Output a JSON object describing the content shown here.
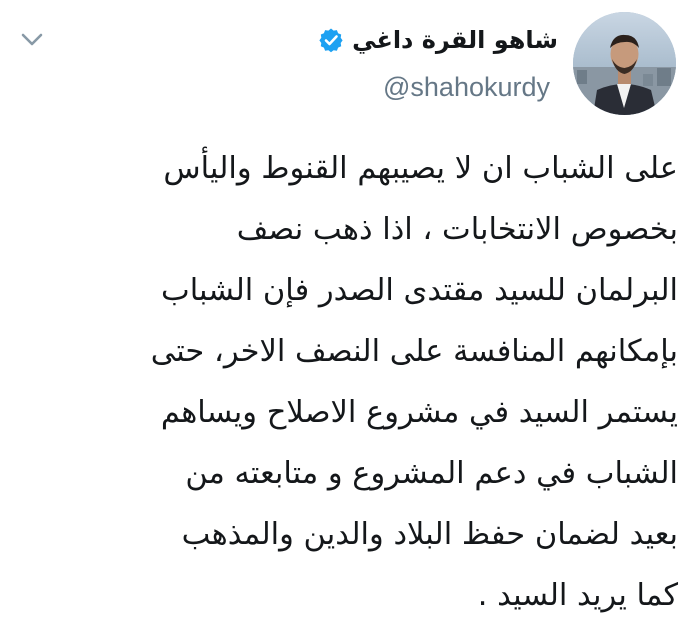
{
  "tweet": {
    "author": {
      "display_name": "شاهو القرة داغي",
      "handle": "@shahokurdy",
      "verified": true
    },
    "text_lines": [
      "على الشباب ان لا يصيبهم القنوط واليأس",
      "بخصوص الانتخابات ، اذا ذهب نصف",
      "البرلمان للسيد مقتدى الصدر فإن الشباب",
      "بإمكانهم المنافسة على النصف الاخر، حتى",
      "يستمر السيد في مشروع الاصلاح ويساهم",
      "الشباب في دعم المشروع و متابعته من",
      "بعيد لضمان حفظ البلاد والدين والمذهب",
      "كما يريد السيد ."
    ]
  },
  "icons": {
    "menu": "chevron-down-icon",
    "verified": "verified-badge-icon"
  },
  "colors": {
    "text": "#14171a",
    "secondary_text": "#657786",
    "verified_blue": "#1da1f2",
    "background": "#ffffff"
  }
}
